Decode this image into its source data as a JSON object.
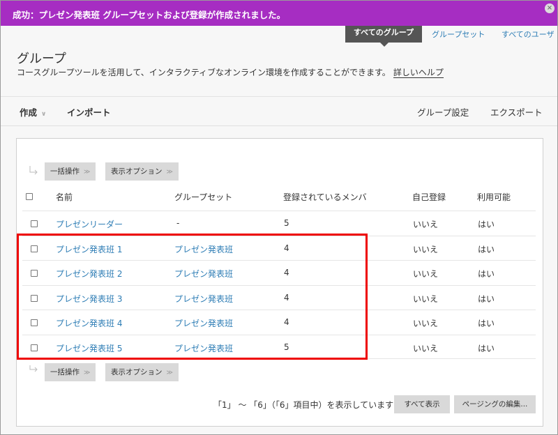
{
  "banner": {
    "message": "成功：プレゼン発表班 グループセットおよび登録が作成されました。",
    "close_icon": "×"
  },
  "tabs": {
    "active": "すべてのグループ",
    "groupsets": "グループセット",
    "all_users": "すべてのユーザ"
  },
  "header": {
    "title": "グループ",
    "description": "コースグループツールを活用して、インタラクティブなオンライン環境を作成することができます。",
    "help_link": "詳しいヘルプ"
  },
  "actionbar": {
    "create": "作成",
    "import": "インポート",
    "group_settings": "グループ設定",
    "export": "エクスポート"
  },
  "toolbar": {
    "bulk_action": "一括操作",
    "display_options": "表示オプション"
  },
  "table": {
    "headers": [
      "名前",
      "グループセット",
      "登録されているメンバ",
      "自己登録",
      "利用可能"
    ],
    "rows": [
      {
        "name": "プレゼンリーダー",
        "groupset": "-",
        "members": "5",
        "self_enroll": "いいえ",
        "available": "はい"
      },
      {
        "name": "プレゼン発表班 1",
        "groupset": "プレゼン発表班",
        "members": "4",
        "self_enroll": "いいえ",
        "available": "はい"
      },
      {
        "name": "プレゼン発表班 2",
        "groupset": "プレゼン発表班",
        "members": "4",
        "self_enroll": "いいえ",
        "available": "はい"
      },
      {
        "name": "プレゼン発表班 3",
        "groupset": "プレゼン発表班",
        "members": "4",
        "self_enroll": "いいえ",
        "available": "はい"
      },
      {
        "name": "プレゼン発表班 4",
        "groupset": "プレゼン発表班",
        "members": "4",
        "self_enroll": "いいえ",
        "available": "はい"
      },
      {
        "name": "プレゼン発表班 5",
        "groupset": "プレゼン発表班",
        "members": "5",
        "self_enroll": "いいえ",
        "available": "はい"
      }
    ]
  },
  "paging": {
    "summary": "「1」 〜 「6」（「6」項目中）を表示しています",
    "show_all": "すべて表示",
    "edit_paging": "ページングの編集..."
  },
  "colors": {
    "banner": "#a62dc2",
    "link": "#2e7db5",
    "highlight": "#e00000"
  }
}
